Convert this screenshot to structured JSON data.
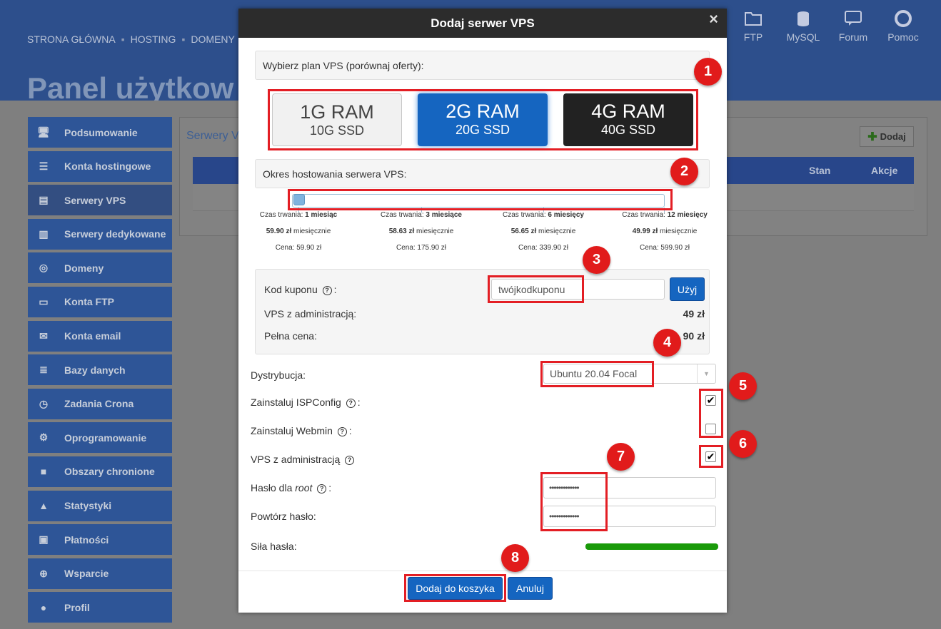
{
  "topnav": {
    "items": [
      "STRONA GŁÓWNA",
      "HOSTING",
      "DOMENY"
    ],
    "sep": "▪"
  },
  "rightnav": [
    {
      "label": "FTP",
      "icon": "folder-icon"
    },
    {
      "label": "MySQL",
      "icon": "database-icon"
    },
    {
      "label": "Forum",
      "icon": "chat-icon"
    },
    {
      "label": "Pomoc",
      "icon": "lifebuoy-icon"
    }
  ],
  "page": {
    "title": "Panel użytkow"
  },
  "sidebar": {
    "items": [
      {
        "label": "Podsumowanie",
        "icon": "monitor-icon"
      },
      {
        "label": "Konta hostingowe",
        "icon": "server-icon"
      },
      {
        "label": "Serwery VPS",
        "icon": "vps-icon"
      },
      {
        "label": "Serwery dedykowane",
        "icon": "dedicated-icon"
      },
      {
        "label": "Domeny",
        "icon": "globe-icon"
      },
      {
        "label": "Konta FTP",
        "icon": "folder-icon"
      },
      {
        "label": "Konta email",
        "icon": "email-icon"
      },
      {
        "label": "Bazy danych",
        "icon": "database-icon"
      },
      {
        "label": "Zadania Crona",
        "icon": "clock-icon"
      },
      {
        "label": "Oprogramowanie",
        "icon": "gear-icon"
      },
      {
        "label": "Obszary chronione",
        "icon": "lock-icon"
      },
      {
        "label": "Statystyki",
        "icon": "chart-icon"
      },
      {
        "label": "Płatności",
        "icon": "wallet-icon"
      },
      {
        "label": "Wsparcie",
        "icon": "lifebuoy-icon"
      },
      {
        "label": "Profil",
        "icon": "user-icon"
      }
    ]
  },
  "panel": {
    "title": "Serwery V",
    "add_label": "Dodaj",
    "columns": {
      "stan": "Stan",
      "akcje": "Akcje"
    }
  },
  "modal": {
    "title": "Dodaj serwer VPS",
    "close": "×",
    "plan_label": "Wybierz plan VPS (porównaj oferty):",
    "plans": [
      {
        "ram": "1G RAM",
        "ssd": "10G SSD",
        "selected": false
      },
      {
        "ram": "2G RAM",
        "ssd": "20G SSD",
        "selected": true
      },
      {
        "ram": "4G RAM",
        "ssd": "40G SSD",
        "selected": false
      }
    ],
    "period_label": "Okres hostowania serwera VPS:",
    "slider_value": 0,
    "periods": [
      {
        "duration_prefix": "Czas trwania: ",
        "duration": "1 miesiąc",
        "monthly_value": "59.90 zł",
        "monthly_suffix": " miesięcznie",
        "price": "Cena: 59.90 zł"
      },
      {
        "duration_prefix": "Czas trwania: ",
        "duration": "3 miesiące",
        "monthly_value": "58.63 zł",
        "monthly_suffix": " miesięcznie",
        "price": "Cena: 175.90 zł"
      },
      {
        "duration_prefix": "Czas trwania: ",
        "duration": "6 miesięcy",
        "monthly_value": "56.65 zł",
        "monthly_suffix": " miesięcznie",
        "price": "Cena: 339.90 zł"
      },
      {
        "duration_prefix": "Czas trwania: ",
        "duration": "12 miesięcy",
        "monthly_value": "49.99 zł",
        "monthly_suffix": " miesięcznie",
        "price": "Cena: 599.90 zł"
      }
    ],
    "coupon": {
      "label": "Kod kuponu",
      "colon": ":",
      "value": "twójkodkuponu",
      "button": "Użyj"
    },
    "admin_row": {
      "label": "VPS z administracją:",
      "value": "49 zł"
    },
    "full_price": {
      "label": "Pełna cena:",
      "value": "90 zł"
    },
    "distro": {
      "label": "Dystrybucja:",
      "value": "Ubuntu 20.04 Focal"
    },
    "ispconfig": {
      "label": "Zainstaluj ISPConfig",
      "colon": ":",
      "checked": true
    },
    "webmin": {
      "label": "Zainstaluj Webmin",
      "colon": ":",
      "checked": false
    },
    "vps_admin": {
      "label": "VPS z administracją",
      "checked": true
    },
    "root_password": {
      "label_prefix": "Hasło dla ",
      "label_em": "root",
      "colon": ":",
      "value": "•••••••••••••"
    },
    "repeat_password": {
      "label": "Powtórz hasło:",
      "value": "•••••••••••••"
    },
    "strength": {
      "label": "Siła hasła:",
      "level": 1.0,
      "color": "#1a9a0a"
    },
    "buttons": {
      "add": "Dodaj do koszyka",
      "cancel": "Anuluj"
    },
    "badges": [
      "1",
      "2",
      "3",
      "4",
      "5",
      "6",
      "7",
      "8"
    ]
  },
  "colors": {
    "accent": "#1565c0",
    "annotation": "#e31e24",
    "header": "#2c2c2c"
  }
}
